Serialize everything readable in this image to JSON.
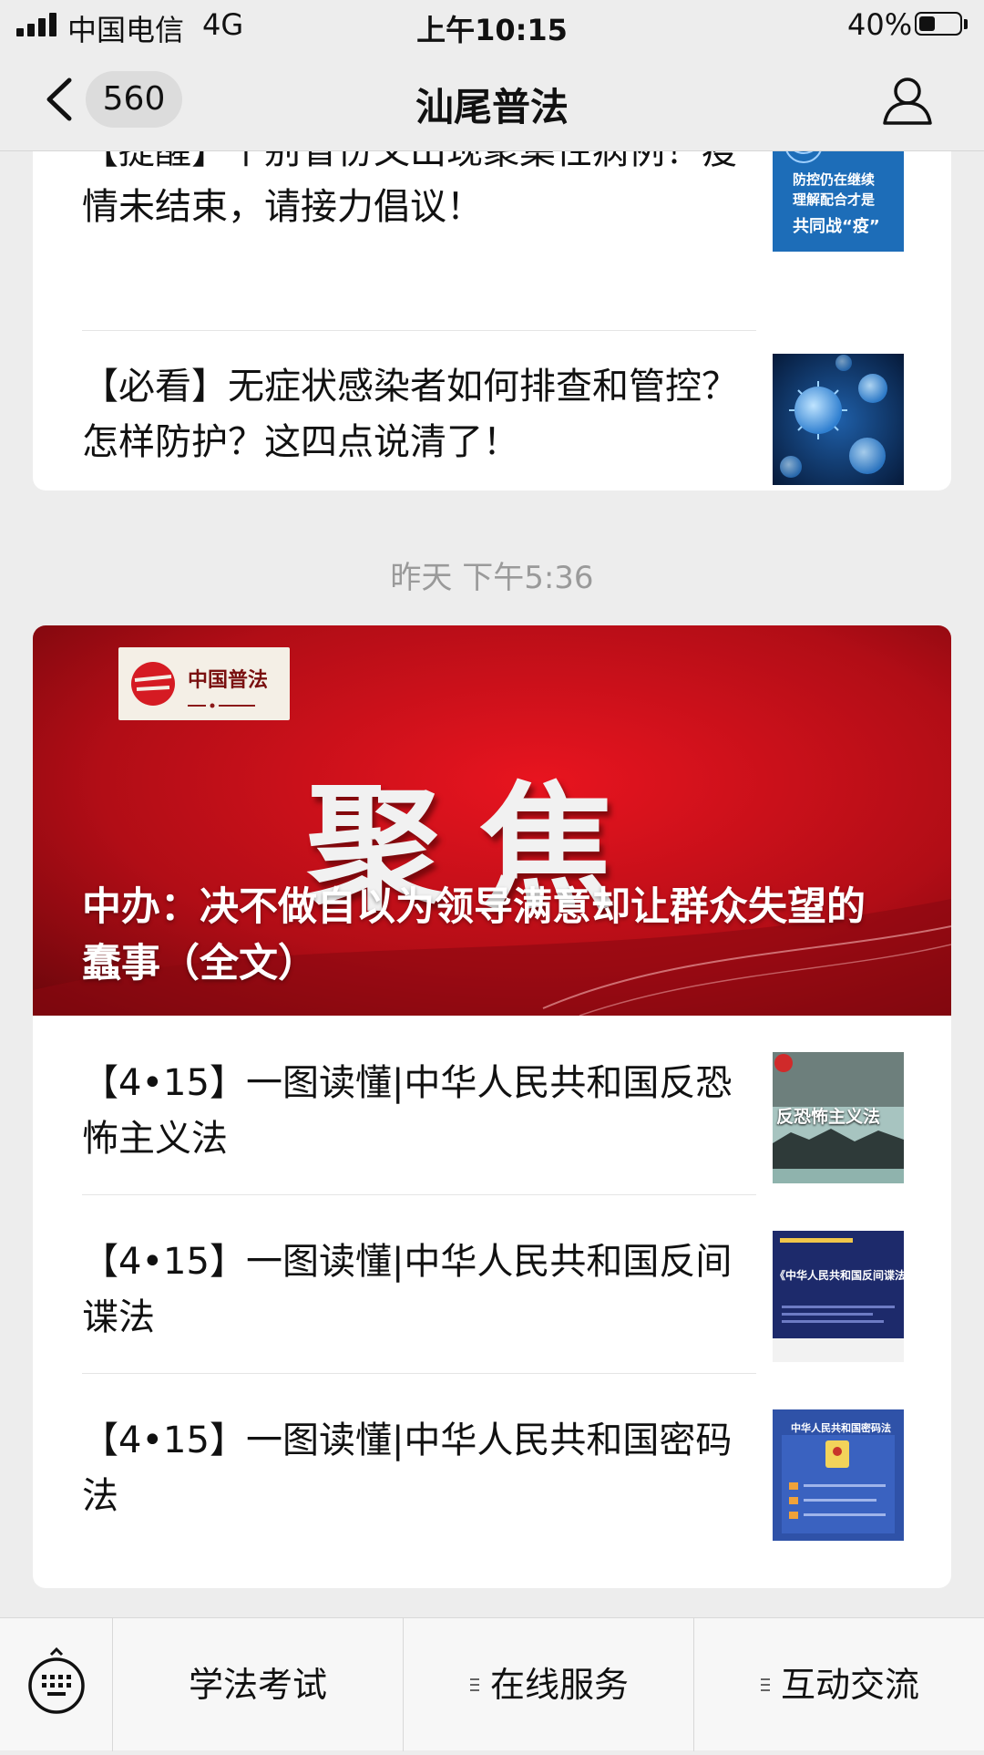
{
  "status_bar": {
    "carrier": "中国电信",
    "network": "4G",
    "time": "上午10:15",
    "battery_percent": "40%",
    "battery_level": 0.4
  },
  "nav": {
    "back_icon": "chevron-left-icon",
    "unread_count": "560",
    "title": "汕尾普法",
    "profile_icon": "user-icon"
  },
  "feed": {
    "card1": {
      "items": [
        {
          "title": "【提醒】个别省份又出现聚集性病例！疫情未结束，请接力倡议！",
          "thumb_text": [
            "防控仍在继续",
            "理解配合才是",
            "共同战“疫”"
          ]
        },
        {
          "title": "【必看】无症状感染者如何排查和管控？怎样防护？这四点说清了！"
        }
      ]
    },
    "timestamp": "昨天 下午5:36",
    "card2": {
      "banner": {
        "logo_text": "中国普法",
        "big_text": "聚焦",
        "title": "中办：决不做自以为领导满意却让群众失望的蠢事（全文）"
      },
      "items": [
        {
          "title": "【4•15】一图读懂|中华人民共和国反恐怖主义法",
          "thumb_text": "反恐怖主义法"
        },
        {
          "title": "【4•15】一图读懂|中华人民共和国反间谍法",
          "thumb_text": "《中华人民共和国反间谍法》"
        },
        {
          "title": "【4•15】一图读懂|中华人民共和国密码法",
          "thumb_text": "中华人民共和国密码法"
        }
      ]
    }
  },
  "bottom_menu": {
    "keyboard_icon": "keyboard-icon",
    "items": [
      {
        "label": "学法考试"
      },
      {
        "label": "在线服务",
        "icon": "menu-lines-icon"
      },
      {
        "label": "互动交流",
        "icon": "menu-lines-icon"
      }
    ]
  },
  "colors": {
    "background": "#ededed",
    "card": "#ffffff",
    "banner_red": "#c8101a",
    "timestamp": "#9a9a9a"
  }
}
